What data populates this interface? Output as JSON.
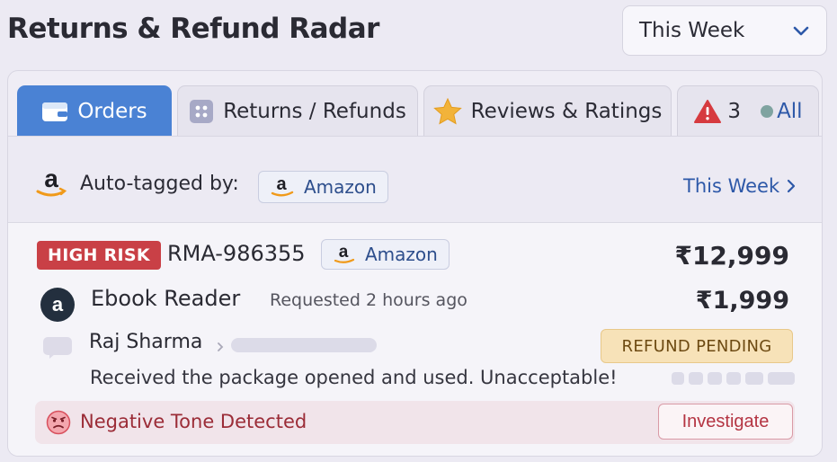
{
  "header": {
    "title": "Returns & Refund Radar",
    "period": "This Week"
  },
  "tabs": [
    {
      "label": "Orders",
      "icon": "wallet-icon"
    },
    {
      "label": "Returns / Refunds",
      "icon": "grid-icon"
    },
    {
      "label": "Reviews & Ratings",
      "icon": "star-icon"
    },
    {
      "count": "3",
      "label": "All",
      "icon": "warning-icon"
    }
  ],
  "tagbar": {
    "label": "Auto-tagged by:",
    "source": "Amazon",
    "period_link": "This Week"
  },
  "ticket": {
    "risk": "HIGH RISK",
    "rma": "RMA-986355",
    "channel": "Amazon",
    "order_total": "₹12,999",
    "product": "Ebook Reader",
    "requested": "Requested 2 hours ago",
    "item_price": "₹1,999",
    "customer": "Raj Sharma",
    "status": "REFUND PENDING",
    "message": "Received the package opened and used. Unacceptable!",
    "alert": "Negative Tone Detected",
    "action": "Investigate"
  },
  "colors": {
    "accent": "#4a82d4",
    "risk": "#c94046",
    "pending": "#f7e2b8",
    "alert": "#b43442"
  }
}
